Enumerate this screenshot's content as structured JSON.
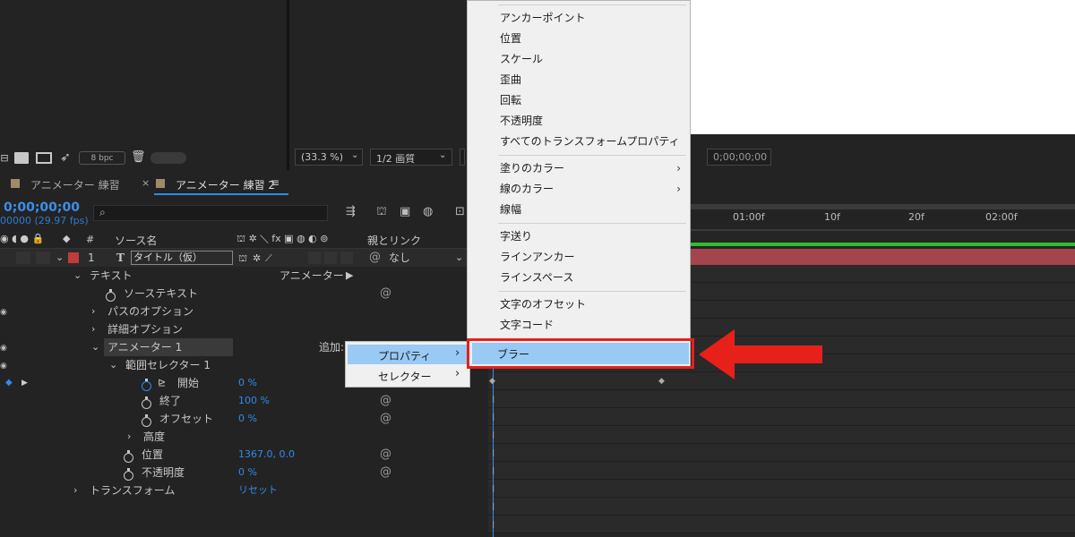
{
  "toolbar_left": {
    "bpc": "8 bpc"
  },
  "viewer_toolbar": {
    "zoom": "(33.3 %)",
    "resolution": "1/2 画質",
    "timecode_right": "0;00;00;00"
  },
  "tabs": [
    {
      "label": "アニメーター 練習",
      "active": false,
      "color": "#a08a6a"
    },
    {
      "label": "アニメーター 練習 2",
      "active": true,
      "color": "#a08a6a"
    }
  ],
  "timeline": {
    "timecode": "0;00;00;00",
    "fps": "00000 (29.97 fps)",
    "search_placeholder": "",
    "headers": {
      "hash": "#",
      "source_name": "ソース名",
      "parent_link": "親とリンク"
    },
    "ruler": [
      "01:00f",
      "10f",
      "20f",
      "02:00f"
    ]
  },
  "layer": {
    "number": "1",
    "type": "T",
    "name": "タイトル（仮）",
    "parent": "なし",
    "label_color": "#c23a3a"
  },
  "props": {
    "text": "テキスト",
    "animator_label": "アニメーター：",
    "source_text": "ソーステキスト",
    "path_options": "パスのオプション",
    "more_options": "詳細オプション",
    "animator1": "アニメーター 1",
    "add": "追加:",
    "range_selector": "範囲セレクター 1",
    "start": "開始",
    "start_val": "0 %",
    "end": "終了",
    "end_val": "100 %",
    "offset": "オフセット",
    "offset_val": "0 %",
    "advanced": "高度",
    "position": "位置",
    "position_val": "1367.0, 0.0",
    "opacity": "不透明度",
    "opacity_val": "0 %",
    "transform": "トランスフォーム",
    "reset": "リセット"
  },
  "submenu": {
    "items": [
      {
        "label": "プロパティ",
        "arrow": "›"
      },
      {
        "label": "セレクター",
        "arrow": "›"
      }
    ]
  },
  "context_menu": {
    "items": [
      "アンカーポイント",
      "位置",
      "スケール",
      "歪曲",
      "回転",
      "不透明度",
      "すべてのトランスフォームプロパティ",
      "塗りのカラー",
      "線のカラー",
      "線幅",
      "字送り",
      "ラインアンカー",
      "ラインスペース",
      "文字のオフセット",
      "文字コード",
      "ブラー"
    ],
    "arrow": "›"
  },
  "colors": {
    "highlight": "#99c9f5",
    "callout_red": "#e8201a",
    "track_green": "#2fbf2f",
    "layer_bar": "#a3454d"
  }
}
